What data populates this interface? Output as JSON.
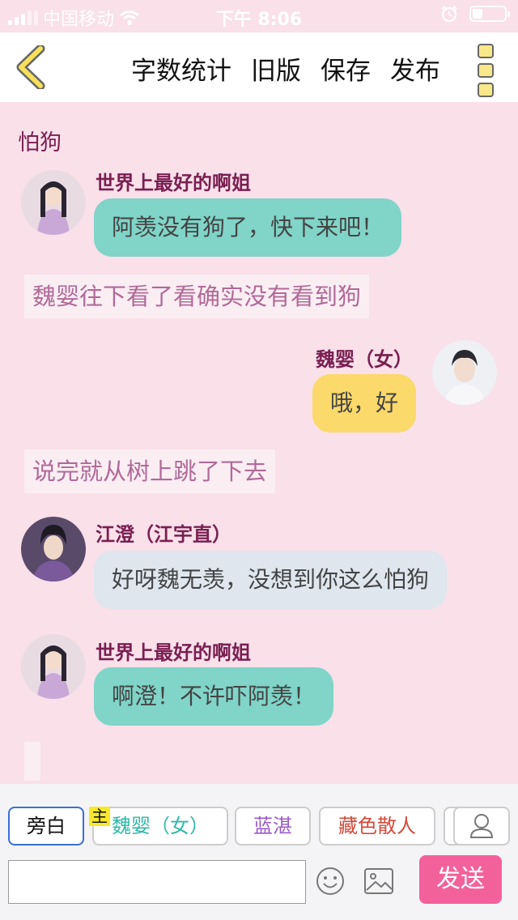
{
  "status_bar": {
    "carrier": "中国移动",
    "time": "下午 8:06",
    "icons": [
      "signal-icon",
      "wifi-icon",
      "alarm-icon",
      "battery-icon"
    ]
  },
  "nav": {
    "back_icon": "chevron-left-icon",
    "actions": [
      "字数统计",
      "旧版",
      "保存",
      "发布"
    ],
    "menu_icon": "more-vertical-icon"
  },
  "chat": {
    "title": "怕狗",
    "messages": [
      {
        "type": "bubble",
        "speaker": "世界上最好的啊姐",
        "text": "阿羡没有狗了，快下来吧！",
        "color": "#80d4c8",
        "side": "left"
      },
      {
        "type": "narration",
        "text": "魏婴往下看了看确实没有看到狗"
      },
      {
        "type": "bubble",
        "speaker": "魏婴（女）",
        "text": "哦，好",
        "color": "#fbd96a",
        "side": "right"
      },
      {
        "type": "narration",
        "text": "说完就从树上跳了下去"
      },
      {
        "type": "bubble",
        "speaker": "江澄（江宇直）",
        "text": "好呀魏无羡，没想到你这么怕狗",
        "color": "#dfe6ee",
        "side": "left"
      },
      {
        "type": "bubble",
        "speaker": "世界上最好的啊姐",
        "text": "啊澄！不许吓阿羡！",
        "color": "#80d4c8",
        "side": "left"
      }
    ]
  },
  "composer": {
    "roles": [
      {
        "label": "旁白",
        "color": "#111111",
        "selected": true
      },
      {
        "label": "魏婴（女）",
        "color": "#2fb8a8",
        "selected": false,
        "badge": "主"
      },
      {
        "label": "蓝湛",
        "color": "#9b59c8",
        "selected": false
      },
      {
        "label": "藏色散人",
        "color": "#d24a3a",
        "selected": false
      }
    ],
    "profile_icon": "user-icon",
    "input_value": "",
    "emoji_icon": "emoji-icon",
    "image_icon": "image-icon",
    "send_label": "发送",
    "send_color": "#f3619b"
  }
}
